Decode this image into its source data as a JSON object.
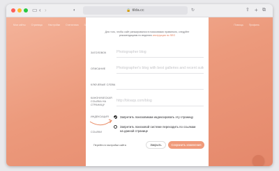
{
  "browser": {
    "url": "tilda.cc"
  },
  "background_nav": {
    "left": [
      "Мои сайты",
      "Страницы",
      "Настройки",
      "Статистика",
      "Заявки",
      "CRM"
    ],
    "right": [
      "Помощь",
      "Профиль"
    ]
  },
  "modal": {
    "note_text": "Для того, чтобы сайт ранжировался в поисковиках правильно, следуйте рекомендациям по ведению ",
    "note_link": "инструкция по SEO",
    "fields": [
      {
        "label": "ЗАГОЛОВОК",
        "placeholder": "Photographer blog"
      },
      {
        "label": "ОПИСАНИЕ",
        "placeholder": "Photographer's blog with best galleries and recent suites"
      },
      {
        "label": "КЛЮЧЕВЫЕ СЛОВА",
        "placeholder": ""
      },
      {
        "label": "КАНОНИЧЕСКАЯ ССЫЛКА НА СТРАНИЦУ",
        "placeholder": "http://bloaqs.com/blog"
      }
    ],
    "indexing_label": "ИНДЕКСАЦИЯ",
    "links_label": "ССЫЛКИ",
    "noindex_option": "Запретить поисковикам индексировать эту страницу",
    "nofollow_option": "Запретить поисковой системе переходить по ссылкам на данной странице",
    "footer_link": "Перейти в настройки сайта",
    "close_label": "Закрыть",
    "save_label": "Сохранить изменения"
  },
  "colors": {
    "accent": "#f09a7a",
    "background_gradient_start": "#f4b39a",
    "background_gradient_end": "#e5886b"
  }
}
